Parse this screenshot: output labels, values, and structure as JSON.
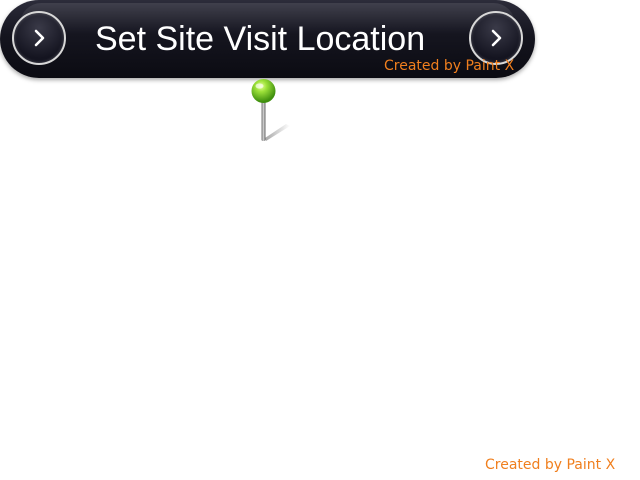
{
  "callout": {
    "title": "Set Site Visit Location",
    "left_button_icon": "chevron-right-icon",
    "right_button_icon": "chevron-right-icon"
  },
  "map": {
    "marker_icon": "map-pin-icon",
    "marker_color": "#7ed321"
  },
  "watermarks": {
    "top": "Created by Paint X",
    "bottom": "Created by Paint X"
  },
  "colors": {
    "bar": "#15151f",
    "watermark": "#f07f1e",
    "background": "#ffffff"
  }
}
